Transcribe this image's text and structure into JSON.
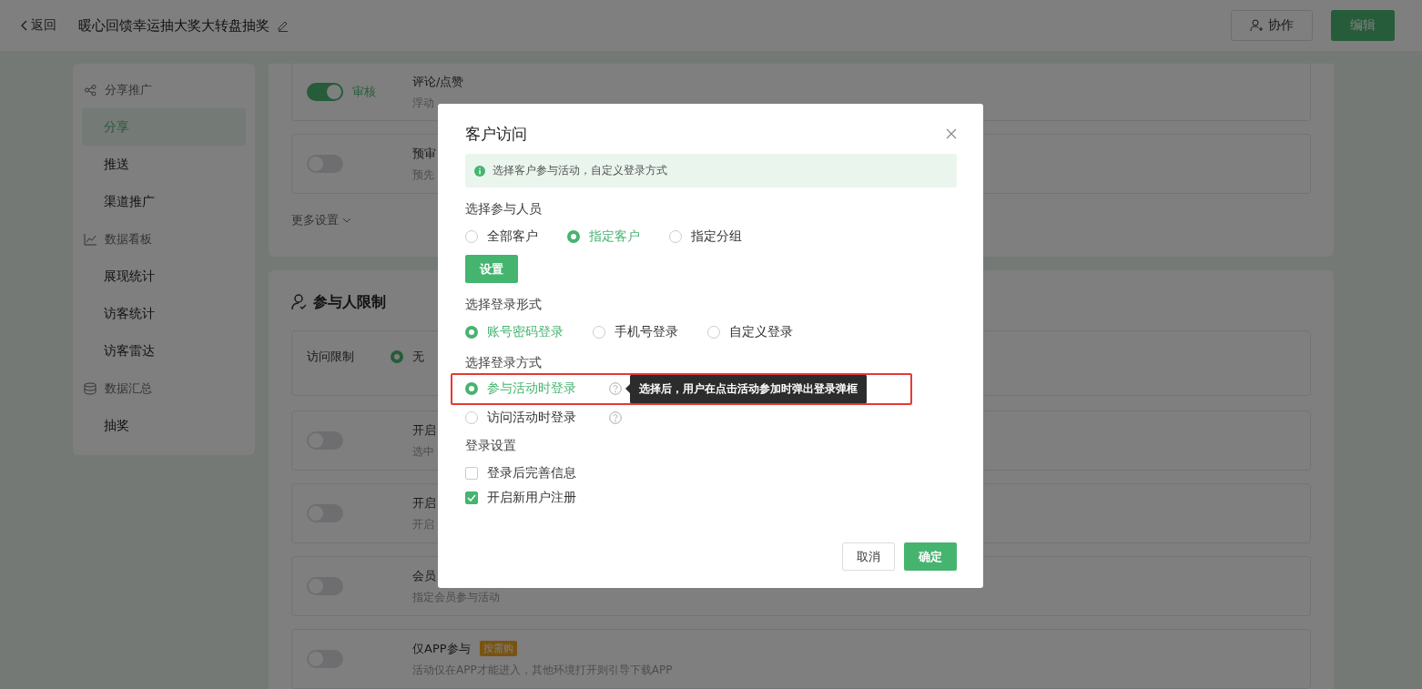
{
  "header": {
    "back_label": "返回",
    "title": "暖心回馈幸运抽大奖大转盘抽奖",
    "buttons": [
      {
        "kind": "collaborate",
        "label": "协作"
      },
      {
        "kind": "primary",
        "label": "编辑"
      }
    ]
  },
  "sidebar": {
    "groups": [
      {
        "kind": "share",
        "label": "分享推广",
        "items": [
          {
            "label": "分享",
            "selected": true
          },
          {
            "label": "推送",
            "selected": false
          },
          {
            "label": "渠道推广",
            "selected": false
          }
        ]
      },
      {
        "kind": "chart",
        "label": "数据看板",
        "items": [
          {
            "label": "展现统计",
            "selected": false
          },
          {
            "label": "访客统计",
            "selected": false
          },
          {
            "label": "访客雷达",
            "selected": false
          }
        ]
      },
      {
        "kind": "database",
        "label": "数据汇总",
        "items": [
          {
            "label": "抽奖",
            "selected": false
          }
        ]
      }
    ]
  },
  "settings_card": {
    "rows": [
      {
        "title": "评论/点赞",
        "description": "浮动",
        "on": true,
        "toggle_label": "审核"
      },
      {
        "title": "预审",
        "description": "预先",
        "on": false
      }
    ],
    "more_label": "更多设置"
  },
  "participant_card": {
    "title": "参与人限制",
    "access": {
      "label": "访问限制",
      "options": [
        {
          "label": "无",
          "selected": true
        }
      ]
    },
    "rows": [
      {
        "title": "开启",
        "description": "选中",
        "on": false
      },
      {
        "title": "开启",
        "description": "开启",
        "on": false
      },
      {
        "title": "会员",
        "description": "指定会员参与活动",
        "on": false
      },
      {
        "title": "仅APP参与",
        "badge": "按需购",
        "description": "活动仅在APP才能进入，其他环境打开则引导下载APP",
        "on": false
      }
    ]
  },
  "modal": {
    "title": "客户访问",
    "info": "选择客户参与活动，自定义登录方式",
    "sections": [
      {
        "kind": "radio",
        "label": "选择参与人员",
        "options": [
          {
            "label": "全部客户",
            "selected": false
          },
          {
            "label": "指定客户",
            "selected": true
          },
          {
            "label": "指定分组",
            "selected": false
          }
        ],
        "button": "设置"
      },
      {
        "kind": "radio",
        "label": "选择登录形式",
        "options": [
          {
            "label": "账号密码登录",
            "selected": true
          },
          {
            "label": "手机号登录",
            "selected": false
          },
          {
            "label": "自定义登录",
            "selected": false
          }
        ]
      },
      {
        "kind": "radio-list",
        "label": "选择登录方式",
        "options": [
          {
            "label": "参与活动时登录",
            "selected": true,
            "highlighted": true,
            "tooltip": "选择后，用户在点击活动参加时弹出登录弹框"
          },
          {
            "label": "访问活动时登录",
            "selected": false,
            "highlighted": false
          }
        ]
      },
      {
        "kind": "checkbox",
        "label": "登录设置",
        "options": [
          {
            "label": "登录后完善信息",
            "checked": false
          },
          {
            "label": "开启新用户注册",
            "checked": true
          }
        ]
      }
    ],
    "buttons": [
      {
        "kind": "cancel",
        "label": "取消"
      },
      {
        "kind": "primary",
        "label": "确定"
      }
    ]
  }
}
